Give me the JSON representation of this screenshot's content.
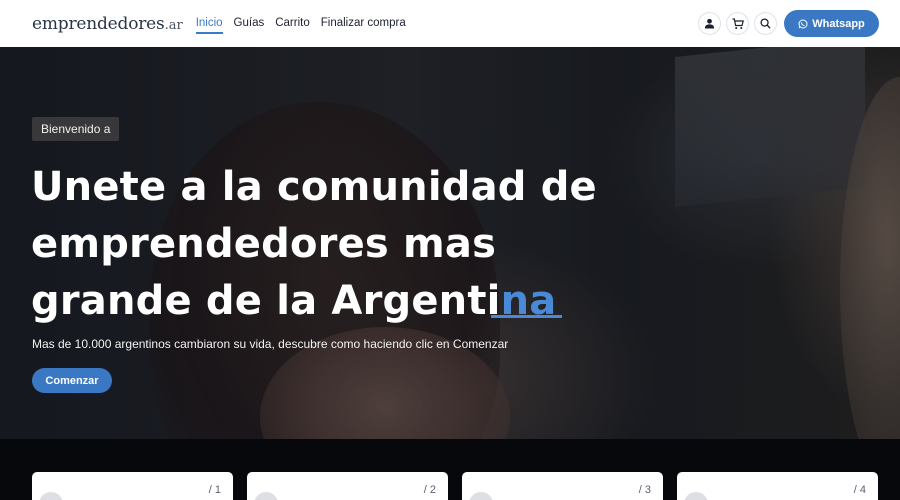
{
  "logo": {
    "main": "emprendedores",
    "ext": ".ar"
  },
  "nav": {
    "items": [
      {
        "label": "Inicio"
      },
      {
        "label": "Guías"
      },
      {
        "label": "Carrito"
      },
      {
        "label": "Finalizar compra"
      }
    ]
  },
  "header": {
    "whatsapp_label": "Whatsapp"
  },
  "hero": {
    "badge": "Bienvenido a",
    "line1": "Unete a la comunidad de",
    "line2": "emprendedores mas",
    "line3_main": "grande de la Argenti",
    "line3_accent": "na",
    "subtitle": "Mas de 10.000 argentinos cambiaron su vida, descubre como haciendo clic en Comenzar",
    "cta": "Comenzar"
  },
  "steps": [
    {
      "number": "/ 1"
    },
    {
      "number": "/ 2"
    },
    {
      "number": "/ 3"
    },
    {
      "number": "/ 4"
    }
  ],
  "colors": {
    "accent": "#3b78c3",
    "accent_text": "#4a89d6"
  }
}
